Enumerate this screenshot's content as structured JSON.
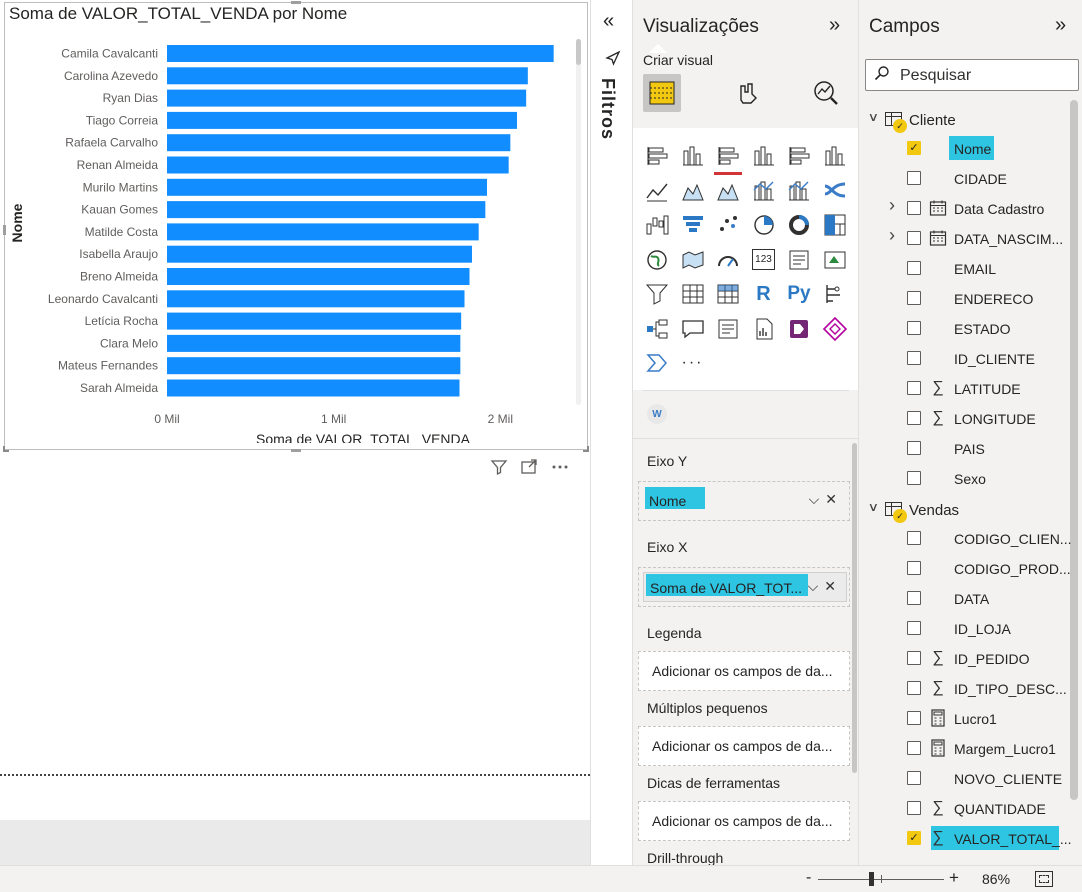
{
  "visual": {
    "title": "Soma de VALOR_TOTAL_VENDA por Nome"
  },
  "chart_data": {
    "type": "bar",
    "orientation": "horizontal",
    "title": "Soma de VALOR_TOTAL_VENDA por Nome",
    "xlabel": "Soma de VALOR_TOTAL_VENDA",
    "ylabel": "Nome",
    "xlim": [
      0,
      2400
    ],
    "xticks": [
      0,
      1000,
      2000
    ],
    "xtick_labels": [
      "0 Mil",
      "1 Mil",
      "2 Mil"
    ],
    "bar_color": "#118DFF",
    "categories": [
      "Camila Cavalcanti",
      "Carolina Azevedo",
      "Ryan Dias",
      "Tiago Correia",
      "Rafaela Carvalho",
      "Renan Almeida",
      "Murilo Martins",
      "Kauan Gomes",
      "Matilde Costa",
      "Isabella Araujo",
      "Breno Almeida",
      "Leonardo Cavalcanti",
      "Letícia Rocha",
      "Clara Melo",
      "Mateus Fernandes",
      "Sarah Almeida"
    ],
    "values": [
      2320,
      2165,
      2155,
      2100,
      2060,
      2050,
      1920,
      1910,
      1870,
      1830,
      1815,
      1785,
      1765,
      1760,
      1760,
      1755
    ]
  },
  "filters_pane": {
    "label": "Filtros"
  },
  "viz_pane": {
    "title": "Visualizações",
    "build_label": "Criar visual",
    "wells": [
      {
        "label": "Eixo Y",
        "field": "Nome",
        "placeholder": ""
      },
      {
        "label": "Eixo X",
        "field": "Soma de VALOR_TOT...",
        "placeholder": ""
      },
      {
        "label": "Legenda",
        "field": "",
        "placeholder": "Adicionar os campos de da..."
      },
      {
        "label": "Múltiplos pequenos",
        "field": "",
        "placeholder": "Adicionar os campos de da..."
      },
      {
        "label": "Dicas de ferramentas",
        "field": "",
        "placeholder": "Adicionar os campos de da..."
      },
      {
        "label": "Drill-through",
        "field": "",
        "placeholder": ""
      }
    ],
    "icons": [
      "stacked-bar",
      "stacked-column",
      "clustered-bar",
      "clustered-column",
      "100-stacked-bar",
      "100-stacked-column",
      "line",
      "area",
      "stacked-area",
      "line-clustered-column",
      "line-stacked-column",
      "ribbon",
      "waterfall",
      "funnel",
      "scatter",
      "pie",
      "donut",
      "treemap",
      "map",
      "filled-map",
      "gauge",
      "card",
      "multi-row-card",
      "kpi",
      "slicer",
      "table",
      "matrix",
      "r-visual",
      "python-visual",
      "key-influencers",
      "decomposition-tree",
      "qa",
      "smart-narrative",
      "paginated-report",
      "power-apps",
      "power-automate",
      "chevron-visual",
      "more"
    ],
    "icon_labels": {
      "r-visual": "R",
      "python-visual": "Py",
      "card": "123",
      "more": "···",
      "w-chip": "W"
    }
  },
  "fields_pane": {
    "title": "Campos",
    "search_placeholder": "Pesquisar",
    "tables": [
      {
        "name": "Cliente",
        "fields": [
          {
            "name": "Nome",
            "type": "text",
            "checked": true,
            "highlight": true,
            "expandable": false
          },
          {
            "name": "CIDADE",
            "type": "text",
            "checked": false,
            "expandable": false
          },
          {
            "name": "Data Cadastro",
            "type": "calendar",
            "checked": false,
            "expandable": true
          },
          {
            "name": "DATA_NASCIM...",
            "type": "calendar",
            "checked": false,
            "expandable": true
          },
          {
            "name": "EMAIL",
            "type": "text",
            "checked": false,
            "expandable": false
          },
          {
            "name": "ENDERECO",
            "type": "text",
            "checked": false,
            "expandable": false
          },
          {
            "name": "ESTADO",
            "type": "text",
            "checked": false,
            "expandable": false
          },
          {
            "name": "ID_CLIENTE",
            "type": "text",
            "checked": false,
            "expandable": false
          },
          {
            "name": "LATITUDE",
            "type": "sigma",
            "checked": false,
            "expandable": false
          },
          {
            "name": "LONGITUDE",
            "type": "sigma",
            "checked": false,
            "expandable": false
          },
          {
            "name": "PAIS",
            "type": "text",
            "checked": false,
            "expandable": false
          },
          {
            "name": "Sexo",
            "type": "text",
            "checked": false,
            "expandable": false
          }
        ]
      },
      {
        "name": "Vendas",
        "fields": [
          {
            "name": "CODIGO_CLIEN...",
            "type": "text",
            "checked": false,
            "expandable": false
          },
          {
            "name": "CODIGO_PROD...",
            "type": "text",
            "checked": false,
            "expandable": false
          },
          {
            "name": "DATA",
            "type": "text",
            "checked": false,
            "expandable": false
          },
          {
            "name": "ID_LOJA",
            "type": "text",
            "checked": false,
            "expandable": false
          },
          {
            "name": "ID_PEDIDO",
            "type": "sigma",
            "checked": false,
            "expandable": false
          },
          {
            "name": "ID_TIPO_DESC...",
            "type": "sigma",
            "checked": false,
            "expandable": false
          },
          {
            "name": "Lucro1",
            "type": "calc",
            "checked": false,
            "expandable": false
          },
          {
            "name": "Margem_Lucro1",
            "type": "calc",
            "checked": false,
            "expandable": false
          },
          {
            "name": "NOVO_CLIENTE",
            "type": "text",
            "checked": false,
            "expandable": false
          },
          {
            "name": "QUANTIDADE",
            "type": "sigma",
            "checked": false,
            "expandable": false
          },
          {
            "name": "VALOR_TOTAL_...",
            "type": "sigma",
            "checked": true,
            "highlight": true,
            "expandable": false
          }
        ]
      }
    ]
  },
  "status_bar": {
    "zoom_minus": "-",
    "zoom_plus": "+",
    "zoom_value": "86%"
  },
  "colors": {
    "bar": "#118DFF",
    "highlight": "#2EC5E3",
    "check": "#F2C811",
    "active_icon_underline": "#D13438"
  }
}
